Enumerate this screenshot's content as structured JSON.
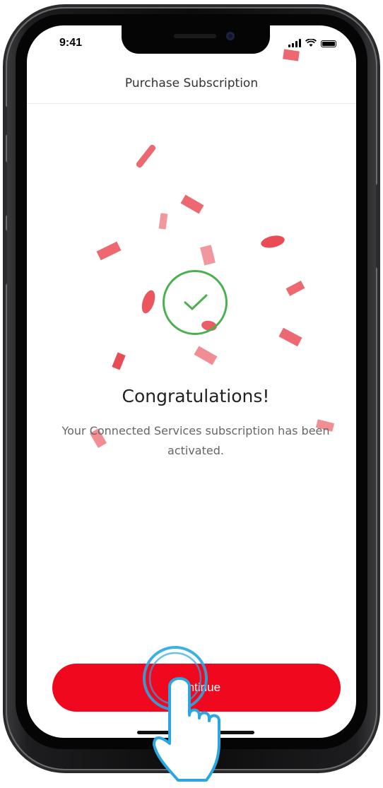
{
  "status_bar": {
    "time": "9:41"
  },
  "header": {
    "title": "Purchase Subscription"
  },
  "success": {
    "icon": "checkmark-circle-icon",
    "title": "Congratulations!",
    "message": "Your Connected Services subscription has been activated."
  },
  "actions": {
    "continue_label": "Continue"
  },
  "colors": {
    "accent": "#f0081f",
    "success": "#4caf50",
    "confetti": "#e8424c"
  }
}
